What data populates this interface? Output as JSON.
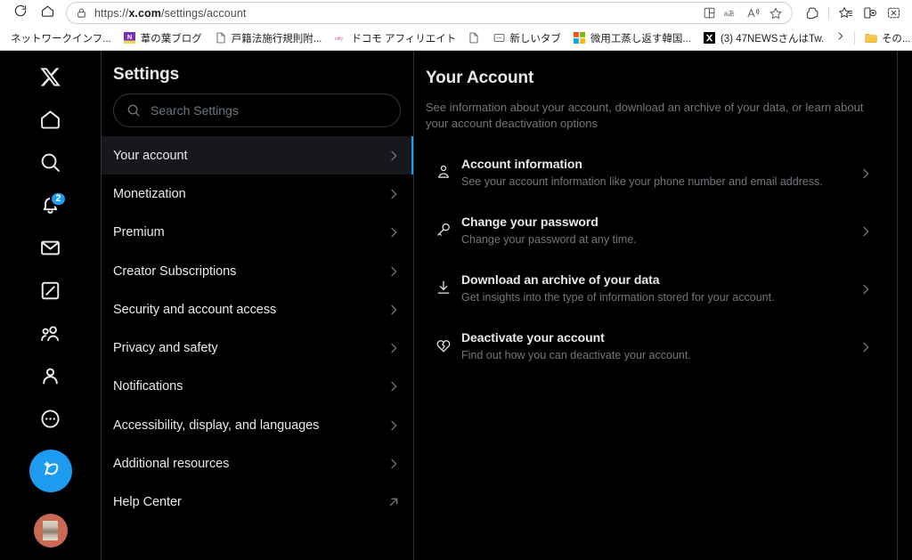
{
  "browser": {
    "nav": {
      "reload_icon": "reload-icon",
      "home_icon": "home-icon"
    },
    "omnibox": {
      "lock_icon": "lock-icon",
      "url_prefix": "https://",
      "url_domain": "x.com",
      "url_path": "/settings/account",
      "url_full": "https://x.com/settings/account",
      "icons": [
        "split-screen-icon",
        "translate-icon",
        "read-aloud-icon",
        "favorite-star-icon"
      ]
    },
    "toolbar_right": [
      "copilot-icon",
      "favorites-icon",
      "collections-icon",
      "browser-essentials-icon"
    ],
    "bookmarks": [
      {
        "label": "ネットワークインフ...",
        "icon": "generic-site-icon"
      },
      {
        "label": "葦の葉ブログ",
        "icon": "blog-icon"
      },
      {
        "label": "戸籍法施行規則附...",
        "icon": "document-icon"
      },
      {
        "label": "ドコモ アフィリエイト | N...",
        "icon": "docomo-icon"
      },
      {
        "label": "",
        "icon": "document-icon"
      },
      {
        "label": "新しいタブ",
        "icon": "new-tab-icon"
      },
      {
        "label": "微用工蒸し返す韓国...",
        "icon": "microsoft-icon"
      },
      {
        "label": "(3) 47NEWSさんはTw...",
        "icon": "x-logo-icon"
      }
    ],
    "bookmarks_overflow_icon": "chevron-right-icon",
    "bookmarks_folder": {
      "label": "その...",
      "icon": "folder-icon"
    }
  },
  "rail": {
    "items": [
      {
        "name": "x-logo",
        "icon": "x-logo-icon",
        "badge": ""
      },
      {
        "name": "home",
        "icon": "home-icon",
        "badge": ""
      },
      {
        "name": "explore",
        "icon": "search-icon",
        "badge": ""
      },
      {
        "name": "notifications",
        "icon": "bell-icon",
        "badge": "2"
      },
      {
        "name": "messages",
        "icon": "envelope-icon",
        "badge": ""
      },
      {
        "name": "grok",
        "icon": "grok-icon",
        "badge": ""
      },
      {
        "name": "communities",
        "icon": "communities-icon",
        "badge": ""
      },
      {
        "name": "profile",
        "icon": "person-icon",
        "badge": ""
      },
      {
        "name": "more",
        "icon": "more-circle-icon",
        "badge": ""
      }
    ],
    "compose": {
      "name": "compose-post",
      "icon": "feather-plus-icon"
    },
    "avatar": {
      "name": "account-avatar",
      "icon": "avatar-image"
    }
  },
  "settings": {
    "title": "Settings",
    "search": {
      "placeholder": "Search Settings",
      "value": "",
      "icon": "search-icon"
    },
    "items": [
      {
        "label": "Your account",
        "chevron": "chevron-right-icon",
        "active": true
      },
      {
        "label": "Monetization",
        "chevron": "chevron-right-icon",
        "active": false
      },
      {
        "label": "Premium",
        "chevron": "chevron-right-icon",
        "active": false
      },
      {
        "label": "Creator Subscriptions",
        "chevron": "chevron-right-icon",
        "active": false
      },
      {
        "label": "Security and account access",
        "chevron": "chevron-right-icon",
        "active": false
      },
      {
        "label": "Privacy and safety",
        "chevron": "chevron-right-icon",
        "active": false
      },
      {
        "label": "Notifications",
        "chevron": "chevron-right-icon",
        "active": false
      },
      {
        "label": "Accessibility, display, and languages",
        "chevron": "chevron-right-icon",
        "active": false
      },
      {
        "label": "Additional resources",
        "chevron": "chevron-right-icon",
        "active": false
      },
      {
        "label": "Help Center",
        "chevron": "external-link-icon",
        "active": false
      }
    ]
  },
  "detail": {
    "title": "Your Account",
    "description": "See information about your account, download an archive of your data, or learn about your account deactivation options",
    "items": [
      {
        "icon": "person-icon",
        "title": "Account information",
        "subtitle": "See your account information like your phone number and email address.",
        "chevron": "chevron-right-icon"
      },
      {
        "icon": "key-icon",
        "title": "Change your password",
        "subtitle": "Change your password at any time.",
        "chevron": "chevron-right-icon"
      },
      {
        "icon": "download-icon",
        "title": "Download an archive of your data",
        "subtitle": "Get insights into the type of information stored for your account.",
        "chevron": "chevron-right-icon"
      },
      {
        "icon": "heart-broken-icon",
        "title": "Deactivate your account",
        "subtitle": "Find out how you can deactivate your account.",
        "chevron": "chevron-right-icon"
      }
    ]
  },
  "colors": {
    "accent_blue": "#1d9bf0",
    "page_background": "#000000",
    "text_primary": "#e7e9ea",
    "text_secondary": "#71767b",
    "border": "#2f3336",
    "active_row": "#16181c",
    "browser_chrome": "#ffffff"
  }
}
